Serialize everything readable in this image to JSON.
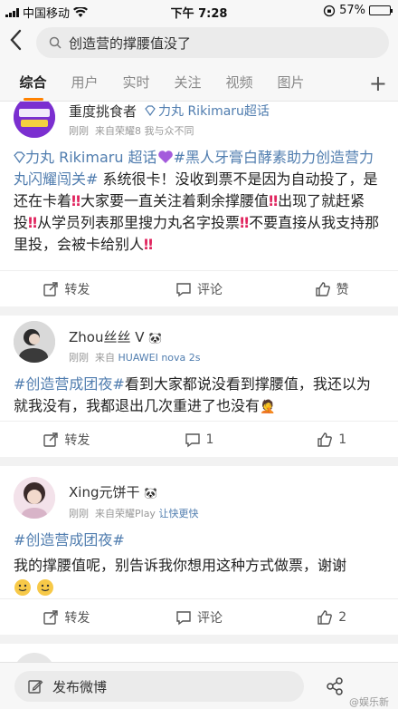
{
  "status_bar": {
    "carrier": "中国移动",
    "time": "下午 7:28",
    "battery": "57%",
    "battery_level": 0.57
  },
  "search": {
    "query": "创造营的撑腰值没了"
  },
  "tabs": [
    {
      "label": "综合",
      "active": true
    },
    {
      "label": "用户"
    },
    {
      "label": "实时"
    },
    {
      "label": "关注"
    },
    {
      "label": "视频"
    },
    {
      "label": "图片"
    }
  ],
  "posts": [
    {
      "username": "重度挑食者",
      "source_tag": "力丸 Rikimaru超话",
      "meta_time": "刚刚",
      "meta_from": "来自荣耀8 我与众不同",
      "text": {
        "t1": "力丸 Rikimaru 超话",
        "t2": "#黑人牙膏白酵素助力创造营力丸闪耀闯关#",
        "t3": " 系统很卡！没收到票不是因为自动投了，是还在卡着",
        "t4": "大家要一直关注着剩余撑腰值",
        "t5": "出现了就赶紧投",
        "t6": "从学员列表那里搜力丸名字投票",
        "t7": "不要直接从我支持那里投，会被卡给别人"
      },
      "actions": {
        "repost": "转发",
        "comment": "评论",
        "like": "赞"
      }
    },
    {
      "username": "Zhou丝丝 V",
      "meta_time": "刚刚",
      "meta_from": "来自",
      "meta_device": "HUAWEI nova 2s",
      "text": {
        "tag": "#创造营成团夜#",
        "body": "看到大家都说没看到撑腰值，我还以为就我没有，我都退出几次重进了也没有"
      },
      "actions": {
        "repost": "转发",
        "comment": "1",
        "like": "1"
      }
    },
    {
      "username": "Xing元饼干",
      "meta_time": "刚刚",
      "meta_from": "来自荣耀Play",
      "meta_device": "让快更快",
      "text": {
        "tag": "#创造营成团夜#",
        "body": "我的撑腰值呢，别告诉我你想用这种方式做票，谢谢"
      },
      "actions": {
        "repost": "转发",
        "comment": "评论",
        "like": "2"
      }
    }
  ],
  "compose": {
    "label": "发布微博"
  },
  "watermark": "@娱乐新闻"
}
